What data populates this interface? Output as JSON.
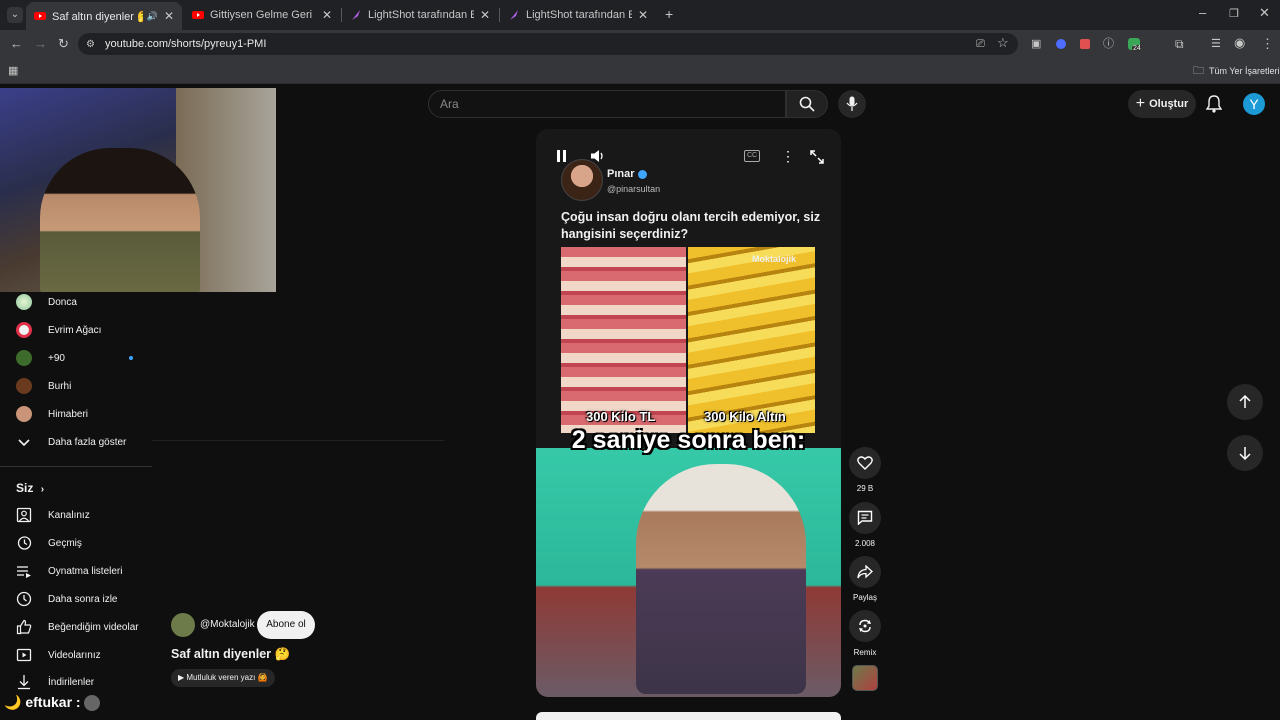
{
  "browser": {
    "tabs": [
      {
        "title": "Saf altın diyenler 🤔 - YouTube",
        "icon": "youtube-icon",
        "active": true
      },
      {
        "title": "Gittiysen Gelme Geri Kedi Versiy",
        "icon": "youtube-icon",
        "active": false
      },
      {
        "title": "LightShot tarafından Ekran Görün",
        "icon": "feather-icon",
        "active": false
      },
      {
        "title": "LightShot tarafından Ekran Görün",
        "icon": "feather-icon",
        "active": false
      }
    ],
    "url": "youtube.com/shorts/pyreuy1-PMI",
    "bookmarks_label": "Tüm Yer İşaretleri",
    "extension_badge": "24"
  },
  "header": {
    "search_placeholder": "Ara",
    "create_label": "Oluştur",
    "avatar_letter": "Y"
  },
  "sidebar": {
    "subscriptions": [
      {
        "label": "Donca"
      },
      {
        "label": "Evrim Ağacı"
      },
      {
        "label": "+90"
      },
      {
        "label": "Burhi"
      },
      {
        "label": "Himaberi"
      }
    ],
    "show_more": "Daha fazla göster",
    "you_heading": "Siz",
    "you_items": [
      {
        "label": "Kanalınız",
        "icon": "channel-icon"
      },
      {
        "label": "Geçmiş",
        "icon": "history-icon"
      },
      {
        "label": "Oynatma listeleri",
        "icon": "playlist-icon"
      },
      {
        "label": "Daha sonra izle",
        "icon": "clock-icon"
      },
      {
        "label": "Beğendiğim videolar",
        "icon": "thumbs-up-icon"
      },
      {
        "label": "Videolarınız",
        "icon": "video-icon"
      },
      {
        "label": "İndirilenler",
        "icon": "download-icon"
      }
    ]
  },
  "short": {
    "author_name": "Pınar",
    "author_handle": "@pinarsultan",
    "question": "Çoğu insan doğru olanı tercih edemiyor, siz hangisini seçerdiniz?",
    "watermark": "Moktalojik",
    "caption_left": "300 Kilo TL",
    "caption_right": "300 Kilo Altın",
    "big_caption": "2 saniye sonra ben:",
    "channel": "@Moktalojik",
    "subscribe_label": "Abone ol",
    "title": "Saf altın diyenler 🤔",
    "music": "Mutluluk veren yazı 🙆"
  },
  "actions": {
    "likes": "29 B",
    "comments": "2.008",
    "share": "Paylaş",
    "remix": "Remix"
  },
  "chat": {
    "line": "eftukar :"
  }
}
